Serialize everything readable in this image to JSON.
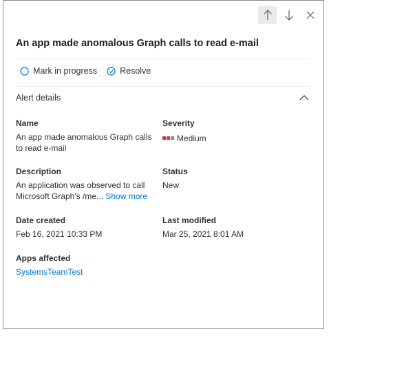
{
  "title": "An app made anomalous Graph calls to read e-mail",
  "toolbar": {
    "up_icon": "arrow-up-icon",
    "down_icon": "arrow-down-icon",
    "close_icon": "close-icon"
  },
  "actions": {
    "mark_in_progress": "Mark in progress",
    "resolve": "Resolve"
  },
  "section": {
    "title": "Alert details",
    "collapse_icon": "chevron-up-icon"
  },
  "details": {
    "name": {
      "label": "Name",
      "line1": "An app made anomalous Graph calls",
      "line2": "to read e-mail"
    },
    "severity": {
      "label": "Severity",
      "value": "Medium",
      "colors": [
        "#d13438",
        "#d13438",
        "#8a8886"
      ]
    },
    "description": {
      "label": "Description",
      "line1": "An application was observed to call",
      "line2": "Microsoft Graph's /me...",
      "show_more": "Show more"
    },
    "status": {
      "label": "Status",
      "value": "New"
    },
    "date_created": {
      "label": "Date created",
      "value": "Feb 16, 2021 10:33 PM"
    },
    "last_modified": {
      "label": "Last modified",
      "value": "Mar 25, 2021 8:01 AM"
    },
    "apps_affected": {
      "label": "Apps affected",
      "value": "SystemsTeamTest"
    }
  },
  "colors": {
    "accent": "#0078d4",
    "severity_high": "#d13438",
    "severity_low": "#8a8886"
  }
}
